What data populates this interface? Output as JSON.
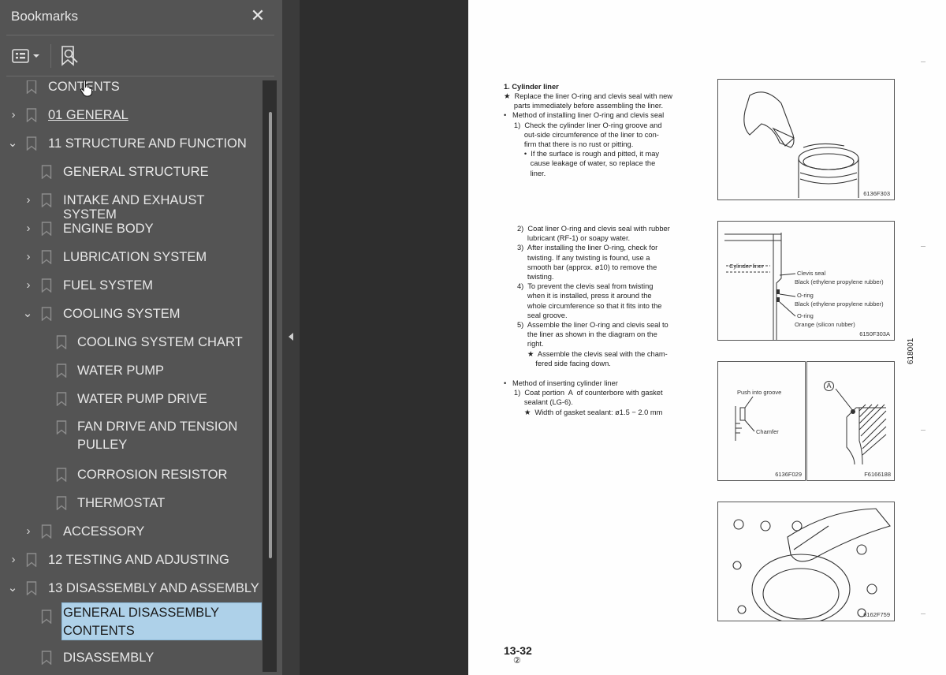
{
  "sidebar": {
    "title": "Bookmarks",
    "close_label": "✕",
    "items": [
      {
        "label": "CONTENTS"
      },
      {
        "label": "01 GENERAL"
      },
      {
        "label": "11 STRUCTURE AND FUNCTION"
      },
      {
        "label": "GENERAL STRUCTURE"
      },
      {
        "label": "INTAKE AND EXHAUST SYSTEM"
      },
      {
        "label": "ENGINE BODY"
      },
      {
        "label": "LUBRICATION SYSTEM"
      },
      {
        "label": "FUEL SYSTEM"
      },
      {
        "label": "COOLING SYSTEM"
      },
      {
        "label": "COOLING SYSTEM CHART"
      },
      {
        "label": "WATER PUMP"
      },
      {
        "label": "WATER PUMP DRIVE"
      },
      {
        "label": "FAN DRIVE AND TENSION PULLEY"
      },
      {
        "label": "CORROSION RESISTOR"
      },
      {
        "label": "THERMOSTAT"
      },
      {
        "label": "ACCESSORY"
      },
      {
        "label": "12 TESTING AND ADJUSTING"
      },
      {
        "label": "13 DISASSEMBLY AND ASSEMBLY"
      },
      {
        "label": "GENERAL DISASSEMBLY CONTENTS"
      },
      {
        "label": "DISASSEMBLY"
      }
    ]
  },
  "document": {
    "heading": "1.  Cylinder liner",
    "lines_a": [
      "★  Replace the liner O-ring and clevis seal with new",
      "     parts immediately before assembling the liner.",
      "•   Method of installing liner O-ring and clevis seal",
      "     1)  Check the cylinder liner O-ring groove and",
      "          out-side circumference of the liner to con-",
      "          firm that there is no rust or pitting.",
      "          •  If the surface is rough and pitted, it may",
      "             cause leakage of water, so replace the",
      "             liner."
    ],
    "lines_b": [
      "2)  Coat liner O-ring and clevis seal with rubber",
      "     lubricant (RF-1) or soapy water.",
      "3)  After installing the liner O-ring, check for",
      "     twisting. If any twisting is found, use a",
      "     smooth bar (approx. ø10) to remove the",
      "     twisting.",
      "4)  To prevent the clevis seal from twisting",
      "     when it is installed, press it around the",
      "     whole circumference so that it fits into the",
      "     seal groove.",
      "5)  Assemble the liner O-ring and clevis seal to",
      "     the liner as shown in the diagram on the",
      "     right.",
      "     ★  Assemble the clevis seal with the cham-",
      "         fered side facing down."
    ],
    "lines_c": [
      "•   Method of inserting cylinder liner",
      "     1)  Coat portion  A  of counterbore with gasket",
      "          sealant (LG-6).",
      "          ★  Width of gasket sealant: ø1.5 − 2.0 mm"
    ],
    "fig1_code": "6136F303",
    "fig2_code": "6150F303A",
    "fig2_labels": {
      "cyl": "Cylinder liner",
      "clevis": "Clevis seal",
      "clevis_mat": "Black (ethylene propylene rubber)",
      "oring1": "O-ring",
      "oring1_mat": "Black (ethylene propylene rubber)",
      "oring2": "O-ring",
      "oring2_mat": "Orange (silicon rubber)"
    },
    "fig3_code": "6136F029",
    "fig3_labels": {
      "push": "Push into groove",
      "chamfer": "Chamfer"
    },
    "fig4_code": "F6166188",
    "fig4_mark": "A",
    "fig5_code": "6162F759",
    "page_number": "13-32",
    "page_sub": "②",
    "side_code": "618001"
  }
}
